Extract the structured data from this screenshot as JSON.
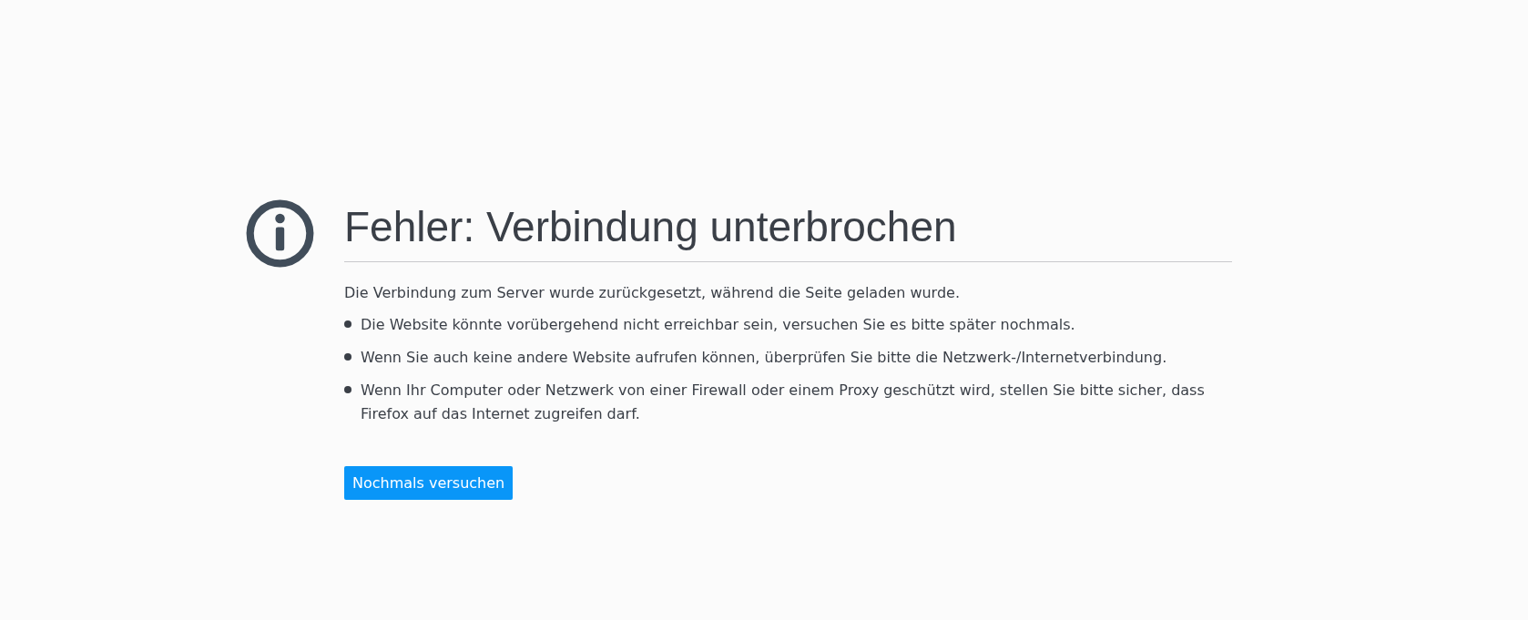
{
  "title": "Fehler: Verbindung unterbrochen",
  "description": "Die Verbindung zum Server wurde zurückgesetzt, während die Seite geladen wurde.",
  "hints": [
    "Die Website könnte vorübergehend nicht erreichbar sein, versuchen Sie es bitte später nochmals.",
    "Wenn Sie auch keine andere Website aufrufen können, überprüfen Sie bitte die Netzwerk-/Internetverbindung.",
    "Wenn Ihr Computer oder Netzwerk von einer Firewall oder einem Proxy geschützt wird, stellen Sie bitte sicher, dass Firefox auf das Internet zugreifen darf."
  ],
  "button": "Nochmals versuchen"
}
